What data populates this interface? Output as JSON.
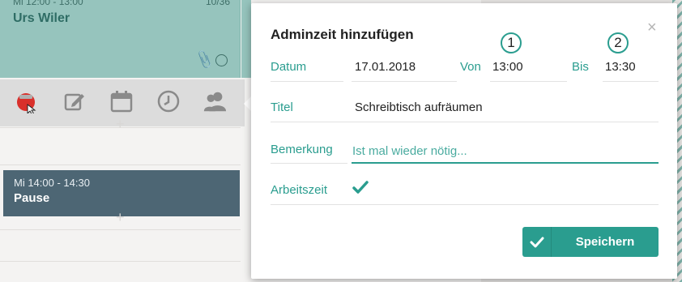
{
  "calendar": {
    "event_top": {
      "time": "Mi 12:00 - 13:00",
      "count": "10/36",
      "name": "Urs Wiler"
    },
    "pause_event": {
      "time": "Mi 14:00 - 14:30",
      "name": "Pause"
    },
    "toolbar_icons": [
      "record-icon",
      "edit-icon",
      "calendar-icon",
      "clock-icon",
      "users-icon"
    ]
  },
  "dialog": {
    "title": "Adminzeit hinzufügen",
    "close_symbol": "×",
    "date_label": "Datum",
    "date_value": "17.01.2018",
    "from_label": "Von",
    "from_value": "13:00",
    "to_label": "Bis",
    "to_value": "13:30",
    "badge_1": "1",
    "badge_2": "2",
    "title_label": "Titel",
    "title_value": "Schreibtisch aufräumen",
    "remark_label": "Bemerkung",
    "remark_value": "Ist mal wieder nötig...",
    "worktime_label": "Arbeitszeit",
    "worktime_checked": true,
    "save_label": "Speichern"
  },
  "colors": {
    "accent": "#2a9d8f",
    "event_bg": "#96c4bd",
    "pause_bg": "#4d6674"
  }
}
